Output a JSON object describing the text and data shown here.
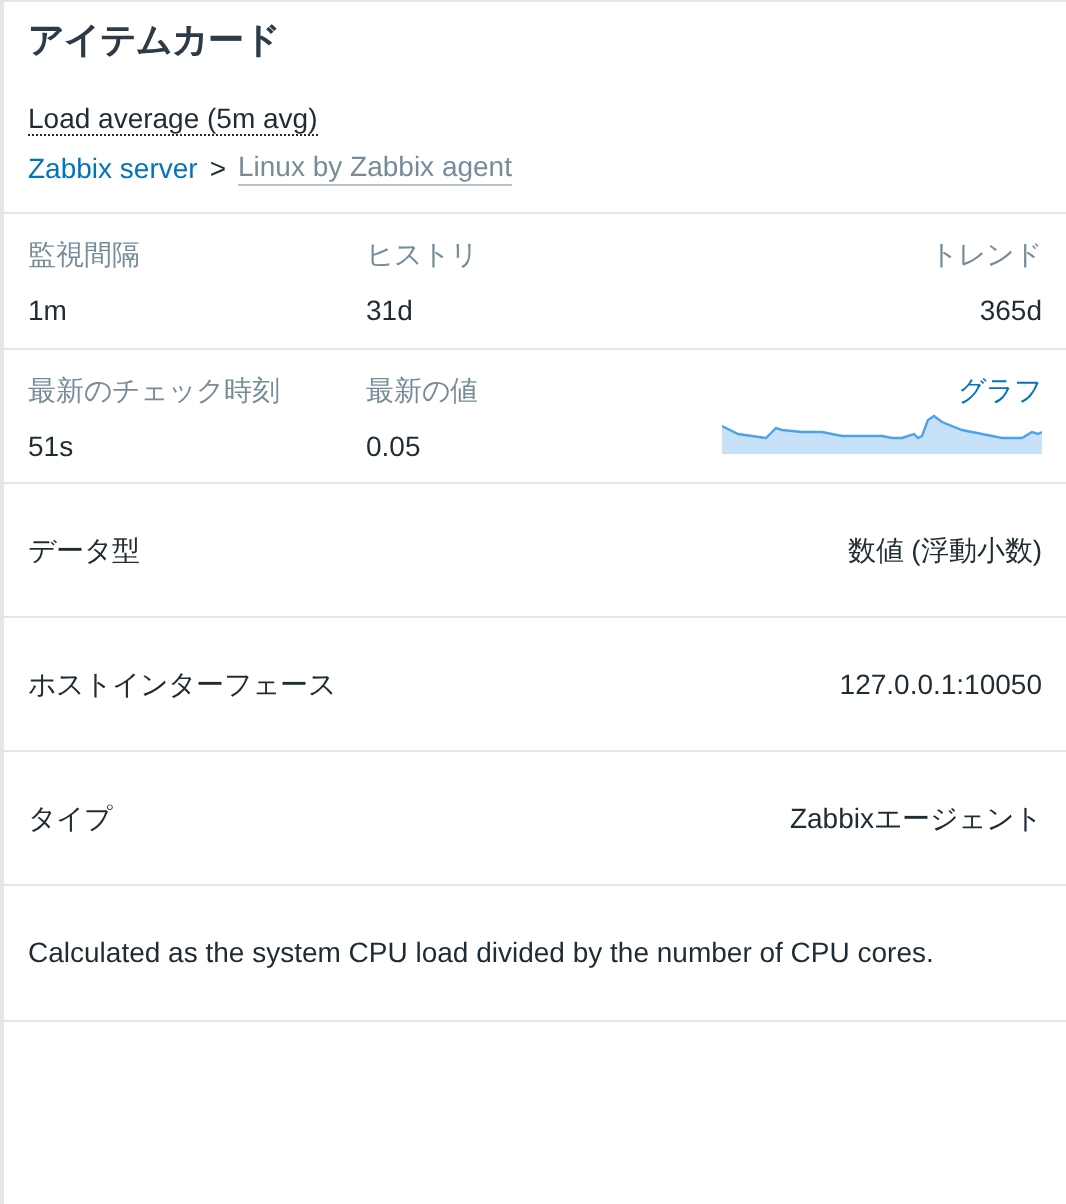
{
  "title": "アイテムカード",
  "item_name": "Load average (5m avg)",
  "breadcrumb": {
    "host": "Zabbix server",
    "separator": ">",
    "template": "Linux by Zabbix agent"
  },
  "intervals": [
    {
      "label": "監視間隔",
      "value": "1m"
    },
    {
      "label": "ヒストリ",
      "value": "31d"
    },
    {
      "label": "トレンド",
      "value": "365d"
    }
  ],
  "latest": {
    "check_label": "最新のチェック時刻",
    "check_value": "51s",
    "value_label": "最新の値",
    "value": "0.05",
    "graph_link": "グラフ"
  },
  "attributes": [
    {
      "label": "データ型",
      "value": "数値 (浮動小数)"
    },
    {
      "label": "ホストインターフェース",
      "value": "127.0.0.1:10050"
    },
    {
      "label": "タイプ",
      "value": "Zabbixエージェント"
    }
  ],
  "description": "Calculated as the system CPU load divided by the number of CPU cores."
}
